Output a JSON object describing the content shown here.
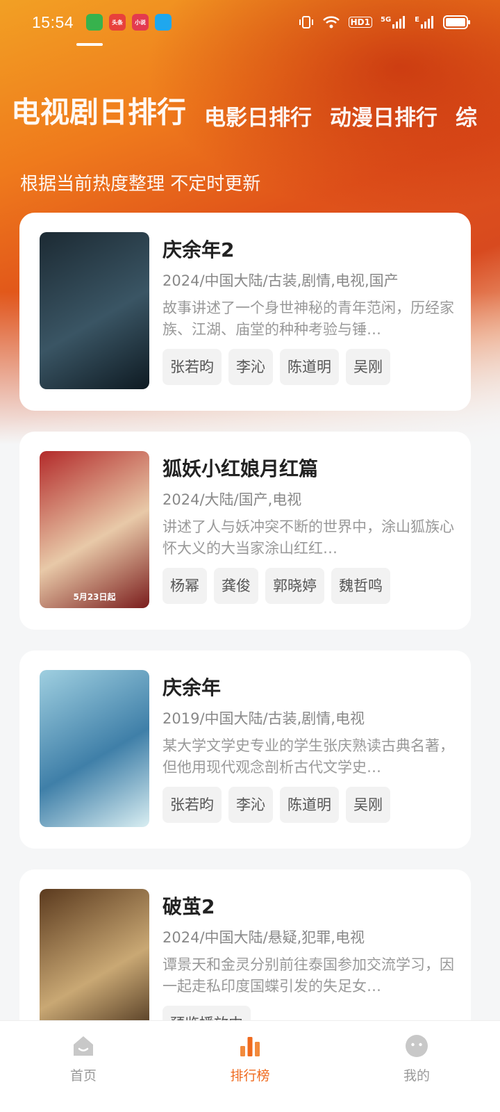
{
  "status_bar": {
    "time": "15:54",
    "apps": [
      {
        "name": "shield-app-icon",
        "label": "",
        "color": "#37b24d"
      },
      {
        "name": "toutiao-app-icon",
        "label": "头条",
        "color": "#e8413b"
      },
      {
        "name": "mini-game-app-icon",
        "label": "小说",
        "color": "#e33a4f"
      },
      {
        "name": "qq-app-icon",
        "label": "",
        "color": "#1fa7ee"
      }
    ],
    "hd_label": "HD1",
    "network_5g": "5G",
    "network_e": "E"
  },
  "tabs": [
    {
      "label": "电视剧日排行",
      "active": true
    },
    {
      "label": "电影日排行",
      "active": false
    },
    {
      "label": "动漫日排行",
      "active": false
    },
    {
      "label": "综",
      "active": false
    }
  ],
  "subtitle": "根据当前热度整理 不定时更新",
  "items": [
    {
      "title": "庆余年2",
      "meta": "2024/中国大陆/古装,剧情,电视,国产",
      "desc": "故事讲述了一个身世神秘的青年范闲，历经家族、江湖、庙堂的种种考验与锤…",
      "tags": [
        "张若昀",
        "李沁",
        "陈道明",
        "吴刚"
      ],
      "poster_colors": [
        "#1c2a33",
        "#3a5564",
        "#0e1a22"
      ],
      "poster_text": ""
    },
    {
      "title": "狐妖小红娘月红篇",
      "meta": "2024/大陆/国产,电视",
      "desc": "讲述了人与妖冲突不断的世界中，涂山狐族心怀大义的大当家涂山红红…",
      "tags": [
        "杨幂",
        "龚俊",
        "郭晓婷",
        "魏哲鸣"
      ],
      "poster_colors": [
        "#b32a2a",
        "#e8c9a8",
        "#7a1c1c"
      ],
      "poster_text": "5月23日起"
    },
    {
      "title": "庆余年",
      "meta": "2019/中国大陆/古装,剧情,电视",
      "desc": "某大学文学史专业的学生张庆熟读古典名著，但他用现代观念剖析古代文学史…",
      "tags": [
        "张若昀",
        "李沁",
        "陈道明",
        "吴刚"
      ],
      "poster_colors": [
        "#9fcfe0",
        "#3f7fa8",
        "#d9eef2"
      ],
      "poster_text": ""
    },
    {
      "title": "破茧2",
      "meta": "2024/中国大陆/悬疑,犯罪,电视",
      "desc": "谭景天和金灵分别前往泰国参加交流学习，因一起走私印度国蝶引发的失足女…",
      "tags": [
        "预览播放中"
      ],
      "poster_colors": [
        "#5b3a1e",
        "#c9a874",
        "#3a2412"
      ],
      "poster_text": ""
    }
  ],
  "bottom_nav": [
    {
      "label": "首页",
      "icon": "home-icon",
      "active": false
    },
    {
      "label": "排行榜",
      "icon": "ranking-chart-icon",
      "active": true
    },
    {
      "label": "我的",
      "icon": "profile-face-icon",
      "active": false
    }
  ],
  "accent_color": "#ef6a1e"
}
